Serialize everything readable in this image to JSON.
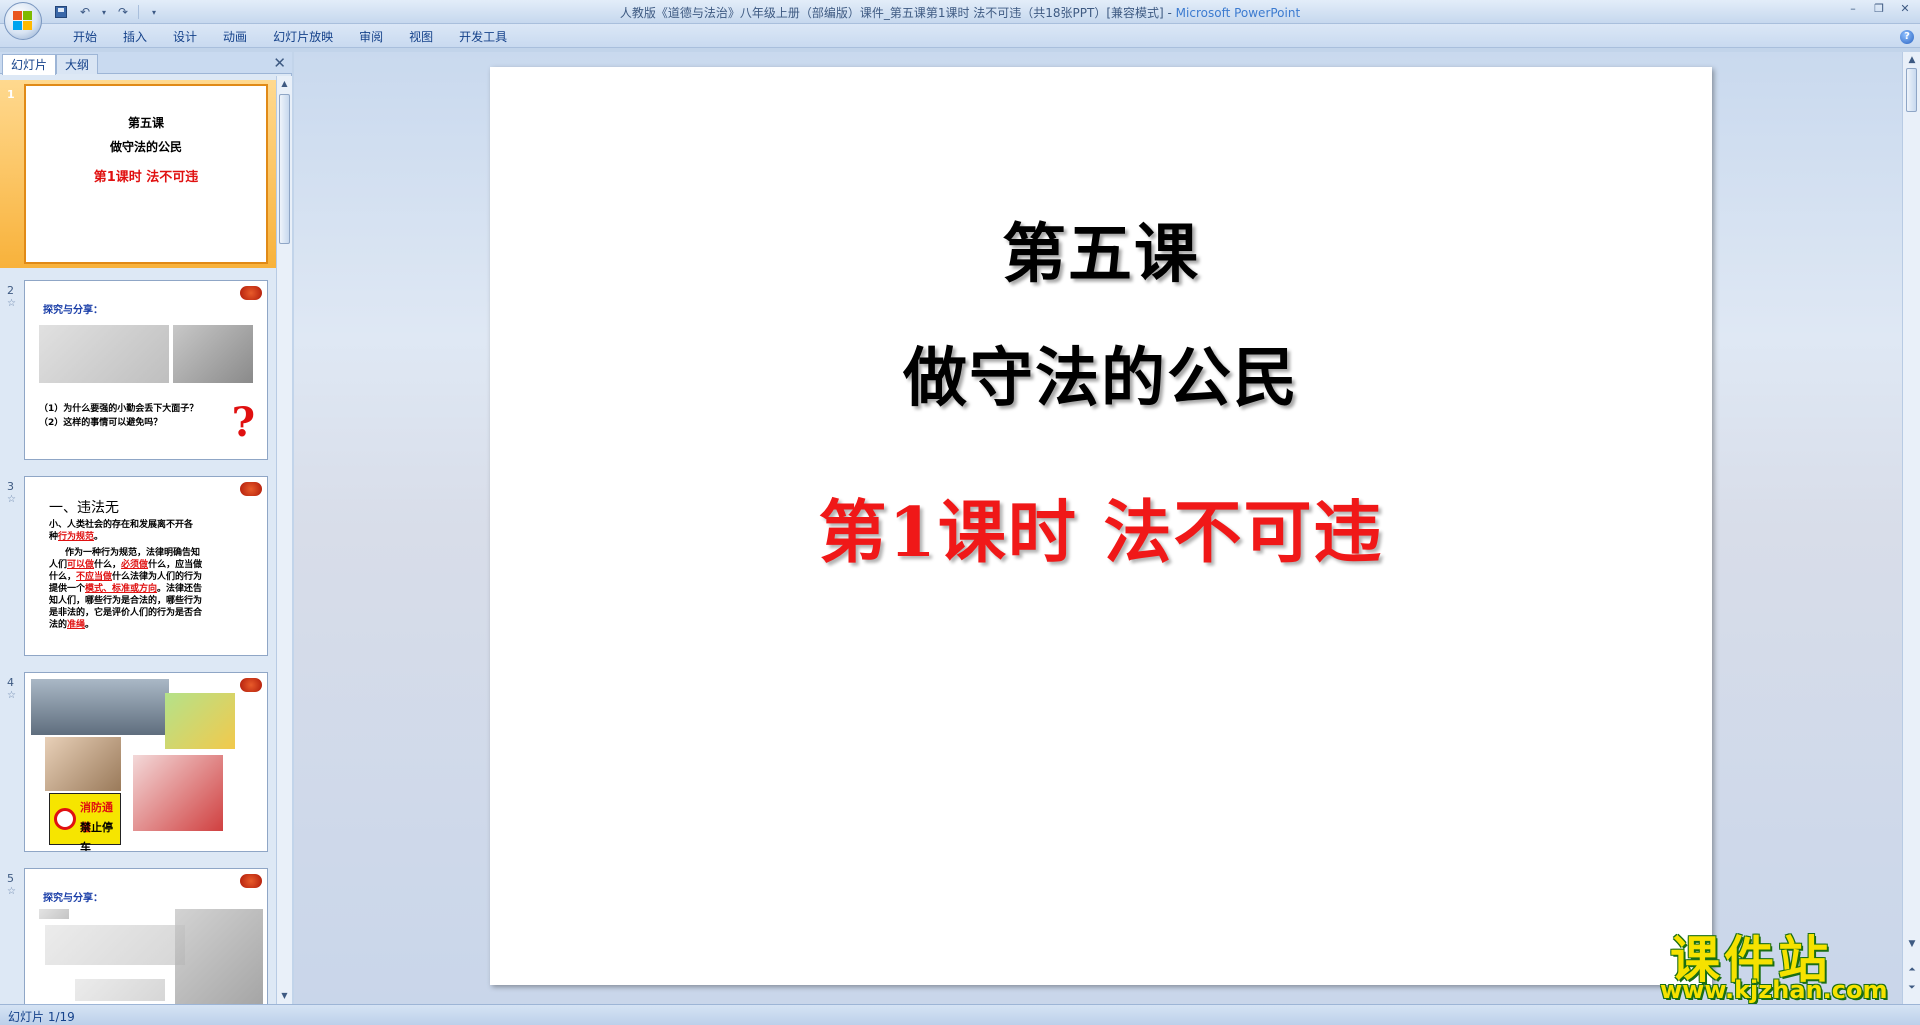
{
  "window": {
    "title_doc": "人教版《道德与法治》八年级上册（部编版）课件_第五课第1课时 法不可违（共18张PPT）[兼容模式]",
    "title_sep": " - ",
    "title_app": "Microsoft PowerPoint"
  },
  "ribbon": {
    "tabs": [
      "开始",
      "插入",
      "设计",
      "动画",
      "幻灯片放映",
      "审阅",
      "视图",
      "开发工具"
    ]
  },
  "left_pane": {
    "tabs": [
      "幻灯片",
      "大纲"
    ],
    "close_glyph": "✕",
    "thumbnails": [
      {
        "number": "1",
        "line1": "第五课",
        "line2": "做守法的公民",
        "line3": "第1课时  法不可违"
      },
      {
        "number": "2",
        "heading": "探究与分享：",
        "q1": "（1）为什么要强的小勤会丢下大面子？",
        "q2": "（2）这样的事情可以避免吗？"
      },
      {
        "number": "3",
        "heading": "一、违法无",
        "p1": "小、人类社会的存在和发展离不开各",
        "p1b": "种",
        "p1c": "行为规范",
        "p1d": "。",
        "p2a": "作为一种行为规范，法律明确告知",
        "p2b": "人们",
        "p2c": "可以做",
        "p2d": "什么，",
        "p2e": "必须做",
        "p2f": "什么，应当做",
        "p2g": "什么，",
        "p2h": "不应当做",
        "p2i": "什么法律为人们的行为",
        "p2j": "提供一个",
        "p2k": "模式、标准或方向",
        "p2l": "。法律还告",
        "p2m": "知人们，哪些行为是合法的，哪些行为",
        "p2n": "是非法的，它是评价人们的行为是否合",
        "p2o": "法的",
        "p2p": "准绳",
        "p2q": "。"
      },
      {
        "number": "4",
        "sign1": "消防通道",
        "sign2": "禁止停车"
      },
      {
        "number": "5",
        "heading": "探究与分享："
      }
    ]
  },
  "slide": {
    "title": "第五课",
    "subtitle": "做守法的公民",
    "lesson": "第1课时  法不可违"
  },
  "status": {
    "slide_info": "幻灯片 1/19"
  },
  "watermark": {
    "text": "课件站",
    "url": "www.kjzhan.com"
  },
  "colors": {
    "lesson_red": "#f01818",
    "selected_thumb": "#f8b23b",
    "ribbon_tab_text": "#15428b"
  }
}
